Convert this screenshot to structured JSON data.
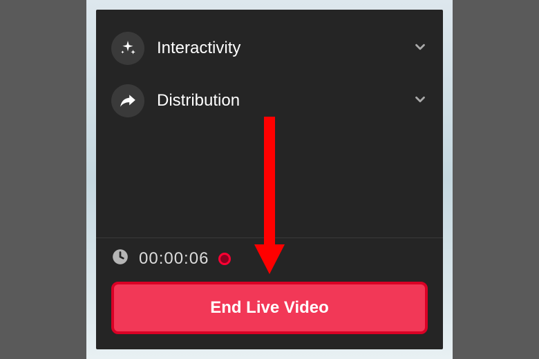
{
  "menu": {
    "items": [
      {
        "label": "Interactivity",
        "icon": "sparkle-icon"
      },
      {
        "label": "Distribution",
        "icon": "share-arrow-icon"
      }
    ]
  },
  "timer": {
    "value": "00:00:06"
  },
  "end_button": {
    "label": "End Live Video"
  },
  "colors": {
    "panel_bg": "#252525",
    "accent_red": "#f23857",
    "highlight_red": "#d90025"
  }
}
